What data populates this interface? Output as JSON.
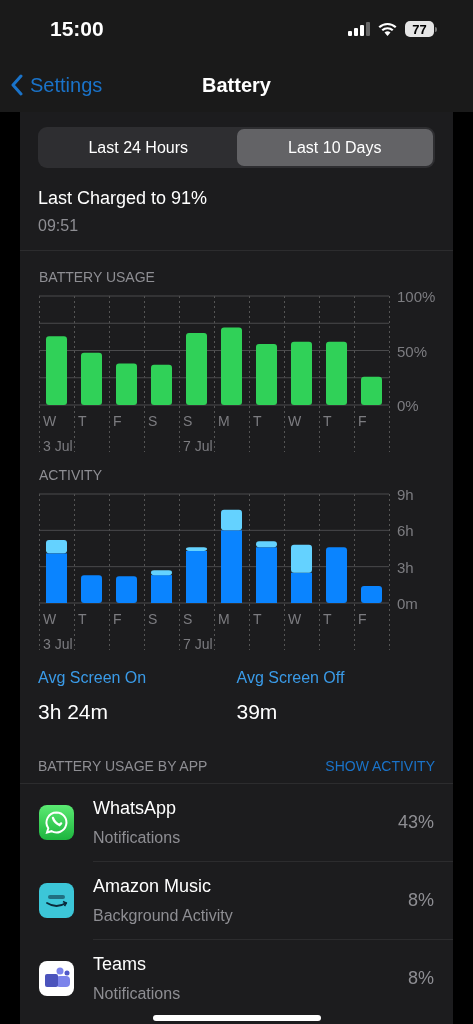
{
  "status_bar": {
    "time": "15:00",
    "battery": "77"
  },
  "nav": {
    "back": "Settings",
    "title": "Battery"
  },
  "segments": [
    {
      "label": "Last 24 Hours",
      "selected": false
    },
    {
      "label": "Last 10 Days",
      "selected": true
    }
  ],
  "last_charged": {
    "title": "Last Charged to 91%",
    "time": "09:51"
  },
  "battery_usage": {
    "title": "BATTERY USAGE",
    "chart_data": {
      "type": "bar",
      "categories": [
        "W",
        "T",
        "F",
        "S",
        "S",
        "M",
        "T",
        "W",
        "T",
        "F"
      ],
      "series": [
        {
          "color": "#30d158",
          "values": [
            63,
            48,
            38,
            37,
            66,
            71,
            56,
            58,
            58,
            26
          ]
        }
      ],
      "ylim": [
        0,
        100
      ],
      "yticks": [
        {
          "value": 0,
          "label": "0%"
        },
        {
          "value": 50,
          "label": "50%"
        },
        {
          "value": 100,
          "label": "100%"
        }
      ]
    },
    "dates": [
      "3 Jul",
      "7 Jul"
    ]
  },
  "activity": {
    "title": "ACTIVITY",
    "chart_data": {
      "type": "bar",
      "stacked": true,
      "categories": [
        "W",
        "T",
        "F",
        "S",
        "S",
        "M",
        "T",
        "W",
        "T",
        "F"
      ],
      "series": [
        {
          "color": "#0a84ff",
          "values": [
            4.1,
            2.3,
            2.2,
            2.3,
            4.3,
            6.0,
            4.6,
            2.5,
            4.6,
            1.4
          ]
        },
        {
          "color": "#64d2ff",
          "values": [
            1.1,
            0,
            0,
            0.4,
            0.3,
            1.7,
            0.5,
            2.3,
            0,
            0
          ]
        }
      ],
      "ylim": [
        0,
        9
      ],
      "yticks": [
        {
          "value": 0,
          "label": "0m"
        },
        {
          "value": 3,
          "label": "3h"
        },
        {
          "value": 6,
          "label": "6h"
        },
        {
          "value": 9,
          "label": "9h"
        }
      ]
    },
    "dates": [
      "3 Jul",
      "7 Jul"
    ]
  },
  "stats": [
    {
      "label": "Avg Screen On",
      "value": "3h 24m"
    },
    {
      "label": "Avg Screen Off",
      "value": "39m"
    }
  ],
  "apps_section": {
    "title": "BATTERY USAGE BY APP",
    "action": "SHOW ACTIVITY"
  },
  "apps": [
    {
      "kind": "chat",
      "name": "WhatsApp",
      "detail": "Notifications",
      "percent": "43%"
    },
    {
      "kind": "music",
      "name": "Amazon Music",
      "detail": "Background Activity",
      "percent": "8%"
    },
    {
      "kind": "teams",
      "name": "Teams",
      "detail": "Notifications",
      "percent": "8%"
    }
  ]
}
